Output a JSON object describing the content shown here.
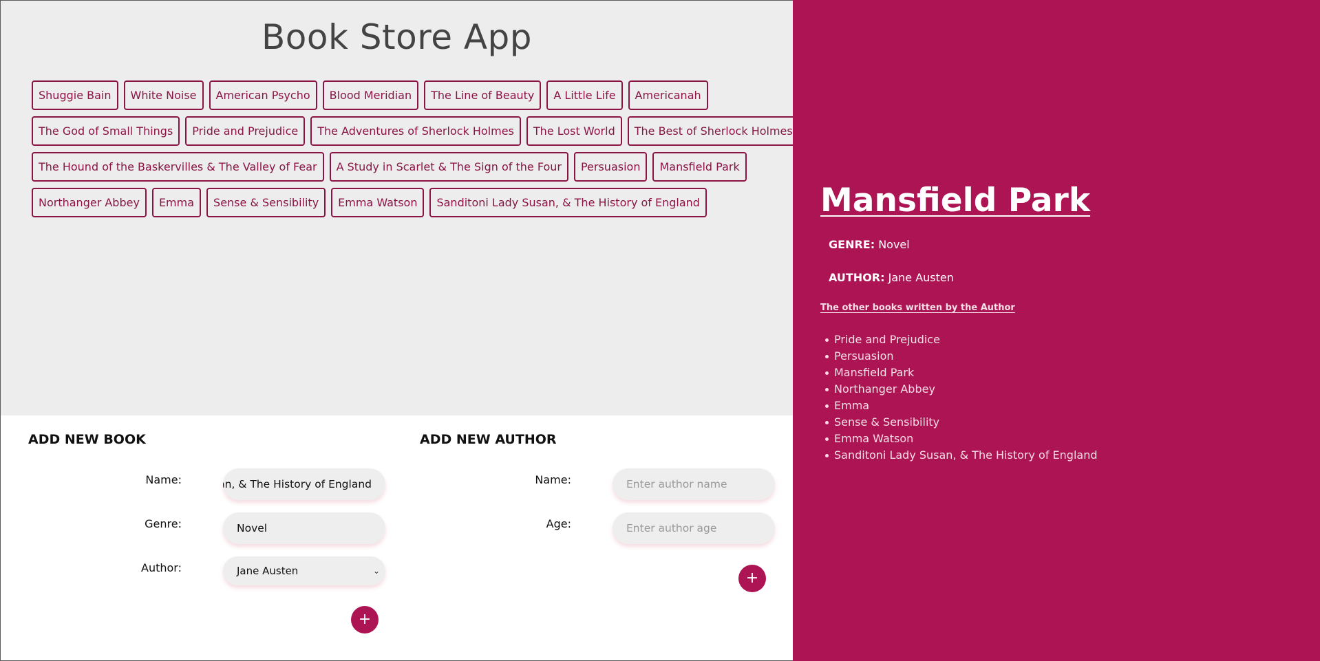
{
  "app": {
    "title": "Book Store App"
  },
  "books": [
    [
      "Shuggie Bain",
      "White Noise",
      "American Psycho",
      "Blood Meridian",
      "The Line of Beauty",
      "A Little Life",
      "Americanah"
    ],
    [
      "The God of Small Things",
      "Pride and Prejudice",
      "The Adventures of Sherlock Holmes",
      "The Lost World",
      "The Best of Sherlock Holmes"
    ],
    [
      "The Hound of the Baskervilles & The Valley of Fear",
      "A Study in Scarlet & The Sign of the Four",
      "Persuasion",
      "Mansfield Park"
    ],
    [
      "Northanger Abbey",
      "Emma",
      "Sense & Sensibility",
      "Emma Watson",
      "Sanditoni Lady Susan, & The History of England"
    ]
  ],
  "add_book": {
    "title": "ADD NEW BOOK",
    "name_label": "Name:",
    "name_value": "an, & The History of England",
    "genre_label": "Genre:",
    "genre_value": "Novel",
    "author_label": "Author:",
    "author_value": "Jane Austen",
    "add_icon": "plus-icon"
  },
  "add_author": {
    "title": "ADD NEW AUTHOR",
    "name_label": "Name:",
    "name_placeholder": "Enter author name",
    "age_label": "Age:",
    "age_placeholder": "Enter author age",
    "add_icon": "plus-icon"
  },
  "detail": {
    "title": "Mansfield Park",
    "genre_label": "GENRE:",
    "genre_value": "Novel",
    "author_label": "AUTHOR:",
    "author_value": "Jane Austen",
    "other_books_label": "The other books written by the Author",
    "other_books": [
      "Pride and Prejudice",
      "Persuasion",
      "Mansfield Park",
      "Northanger Abbey",
      "Emma",
      "Sense & Sensibility",
      "Emma Watson",
      "Sanditoni Lady Susan, & The History of England"
    ]
  },
  "colors": {
    "accent": "#ad1453",
    "chip_border": "#8a1545",
    "panel_bg": "#ededed"
  }
}
